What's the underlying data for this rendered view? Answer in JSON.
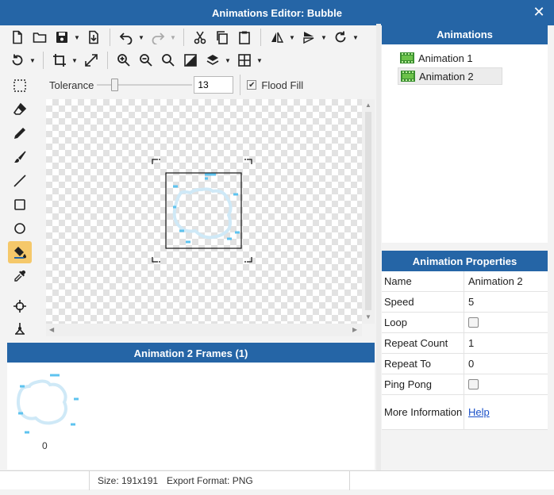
{
  "window": {
    "title": "Animations Editor: Bubble",
    "close_glyph": "✕"
  },
  "toolbar": {
    "row1": [
      "new-file-icon",
      "open-folder-icon",
      "save-icon",
      "export-icon",
      "undo-icon",
      "redo-icon",
      "cut-icon",
      "copy-icon",
      "paste-icon",
      "flip-horizontal-icon",
      "flip-vertical-icon",
      "rotate-icon"
    ],
    "row2": [
      "rotate-mode-icon",
      "crop-icon",
      "resize-icon",
      "zoom-in-icon",
      "zoom-out-icon",
      "zoom-actual-icon",
      "invert-icon",
      "layers-icon",
      "grid-icon"
    ]
  },
  "options": {
    "tolerance_label": "Tolerance",
    "tolerance_value": "13",
    "tolerance_fraction": 0.16,
    "flood_fill_label": "Flood Fill",
    "flood_fill_checked": true
  },
  "tools": [
    "selection-icon",
    "eraser-icon",
    "pencil-icon",
    "brush-icon",
    "line-icon",
    "rectangle-icon",
    "ellipse-icon",
    "fill-bucket-icon",
    "eyedropper-icon",
    "target-icon",
    "move-anchor-icon"
  ],
  "active_tool": "fill-bucket-icon",
  "frames_panel": {
    "title": "Animation 2 Frames (1)",
    "frames": [
      {
        "label": "0"
      }
    ]
  },
  "animations_panel": {
    "title": "Animations",
    "items": [
      {
        "label": "Animation 1",
        "selected": false
      },
      {
        "label": "Animation 2",
        "selected": true
      }
    ]
  },
  "properties_panel": {
    "title": "Animation Properties",
    "rows": [
      {
        "name": "Name",
        "value": "Animation 2",
        "kind": "text"
      },
      {
        "name": "Speed",
        "value": "5",
        "kind": "text"
      },
      {
        "name": "Loop",
        "value": "",
        "kind": "checkbox",
        "checked": false
      },
      {
        "name": "Repeat Count",
        "value": "1",
        "kind": "text"
      },
      {
        "name": "Repeat To",
        "value": "0",
        "kind": "text"
      },
      {
        "name": "Ping Pong",
        "value": "",
        "kind": "checkbox",
        "checked": false
      },
      {
        "name": "More Information",
        "value": "Help",
        "kind": "link"
      }
    ]
  },
  "status": {
    "size": "Size: 191x191",
    "format": "Export Format: PNG"
  },
  "colors": {
    "accent": "#2565a6",
    "active_tool": "#f5c86a",
    "sprite_light": "#cfe9f7",
    "sprite_dark": "#5ec3ef"
  }
}
